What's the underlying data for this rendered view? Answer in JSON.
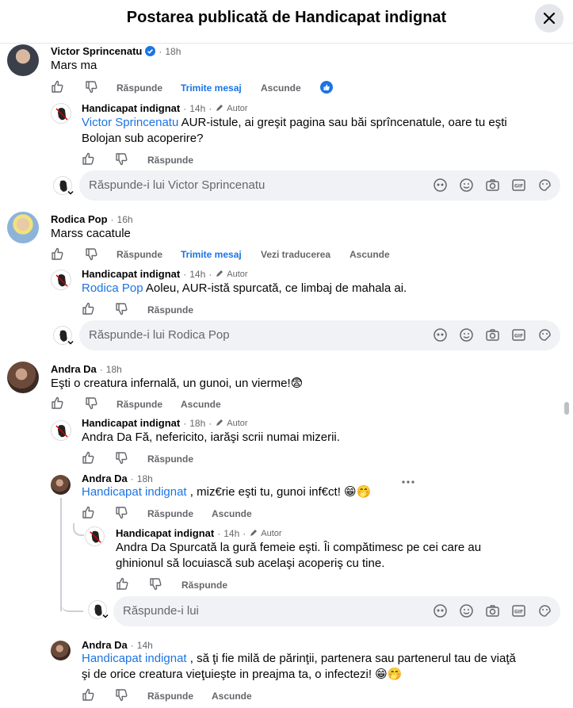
{
  "header": {
    "title": "Postarea publicată de Handicapat indignat"
  },
  "actions": {
    "reply": "Răspunde",
    "send_message": "Trimite mesaj",
    "hide": "Ascunde",
    "see_translation": "Vezi traducerea"
  },
  "author_badge": "Autor",
  "comments": [
    {
      "name": "Victor Sprincenatu",
      "time": "18h",
      "text": "Mars ma",
      "reply": {
        "name": "Handicapat indignat",
        "time": "14h",
        "mention": "Victor Sprincenatu",
        "text1": " AUR-istule, ai greşit pagina sau băi sprîncenatule, oare tu eşti",
        "text2": "Bolojan sub acoperire?"
      },
      "reply_placeholder": "Răspunde-i lui Victor Sprincenatu"
    },
    {
      "name": "Rodica Pop",
      "time": "16h",
      "text": "Marss cacatule",
      "reply": {
        "name": "Handicapat indignat",
        "time": "14h",
        "mention": "Rodica Pop",
        "text1": " Aoleu, AUR-istă spurcată, ce limbaj de mahala ai."
      },
      "reply_placeholder": "Răspunde-i lui Rodica Pop"
    },
    {
      "name": "Andra Da",
      "time": "18h",
      "text": "Eşti o creatura infernală, un gunoi, un vierme!😨",
      "reply": {
        "name": "Handicapat indignat",
        "time": "18h",
        "text1": "Andra Da Fă, nefericito, iarăşi scrii numai mizerii."
      },
      "reply2": {
        "name": "Andra Da",
        "time": "18h",
        "mention": "Handicapat indignat",
        "text1": " , miz€rie eşti tu, gunoi inf€ct! 😁🤭"
      },
      "reply3": {
        "name": "Handicapat indignat",
        "time": "14h",
        "text1": "Andra Da Spurcată la gură femeie eşti. Îi compătimesc pe cei care au",
        "text2": "ghinionul să locuiască sub acelaşi acoperiş cu tine."
      },
      "reply_placeholder": "Răspunde-i lui",
      "reply4": {
        "name": "Andra Da",
        "time": "14h",
        "mention": "Handicapat indignat",
        "text1": " , să ţi fie milă de părinţii, partenera sau partenerul tau de viaţă",
        "text2": "şi de orice creatura vieţuieşte in preajma ta, o infectezi! 😁🤭"
      }
    }
  ]
}
